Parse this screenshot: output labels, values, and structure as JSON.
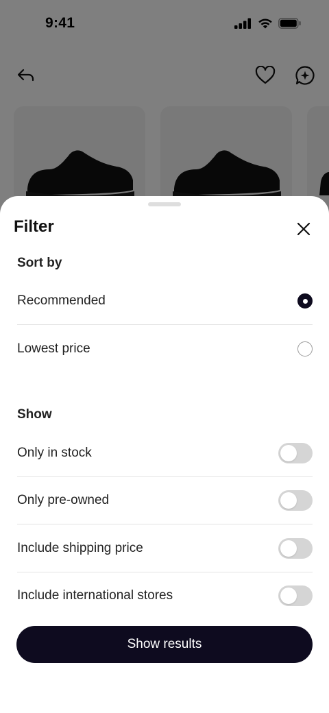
{
  "status_bar": {
    "time": "9:41"
  },
  "header": {
    "back_icon": "back-arrow-icon",
    "favorite_icon": "heart-icon",
    "assistant_icon": "sparkle-chat-icon"
  },
  "products": [
    {
      "image": "black-sneaker"
    },
    {
      "image": "black-sneaker"
    },
    {
      "image": "black-sneaker"
    }
  ],
  "filter": {
    "title": "Filter",
    "close_icon": "close-icon",
    "sort": {
      "title": "Sort by",
      "options": [
        {
          "label": "Recommended",
          "selected": true
        },
        {
          "label": "Lowest price",
          "selected": false
        }
      ]
    },
    "show": {
      "title": "Show",
      "toggles": [
        {
          "label": "Only in stock",
          "on": false
        },
        {
          "label": "Only pre-owned",
          "on": false
        },
        {
          "label": "Include shipping price",
          "on": false
        },
        {
          "label": "Include international stores",
          "on": false
        }
      ]
    },
    "submit_label": "Show results"
  },
  "colors": {
    "primary": "#0e0b1f",
    "toggle_off": "#d5d5d5",
    "overlay": "rgba(0,0,0,0.5)"
  }
}
